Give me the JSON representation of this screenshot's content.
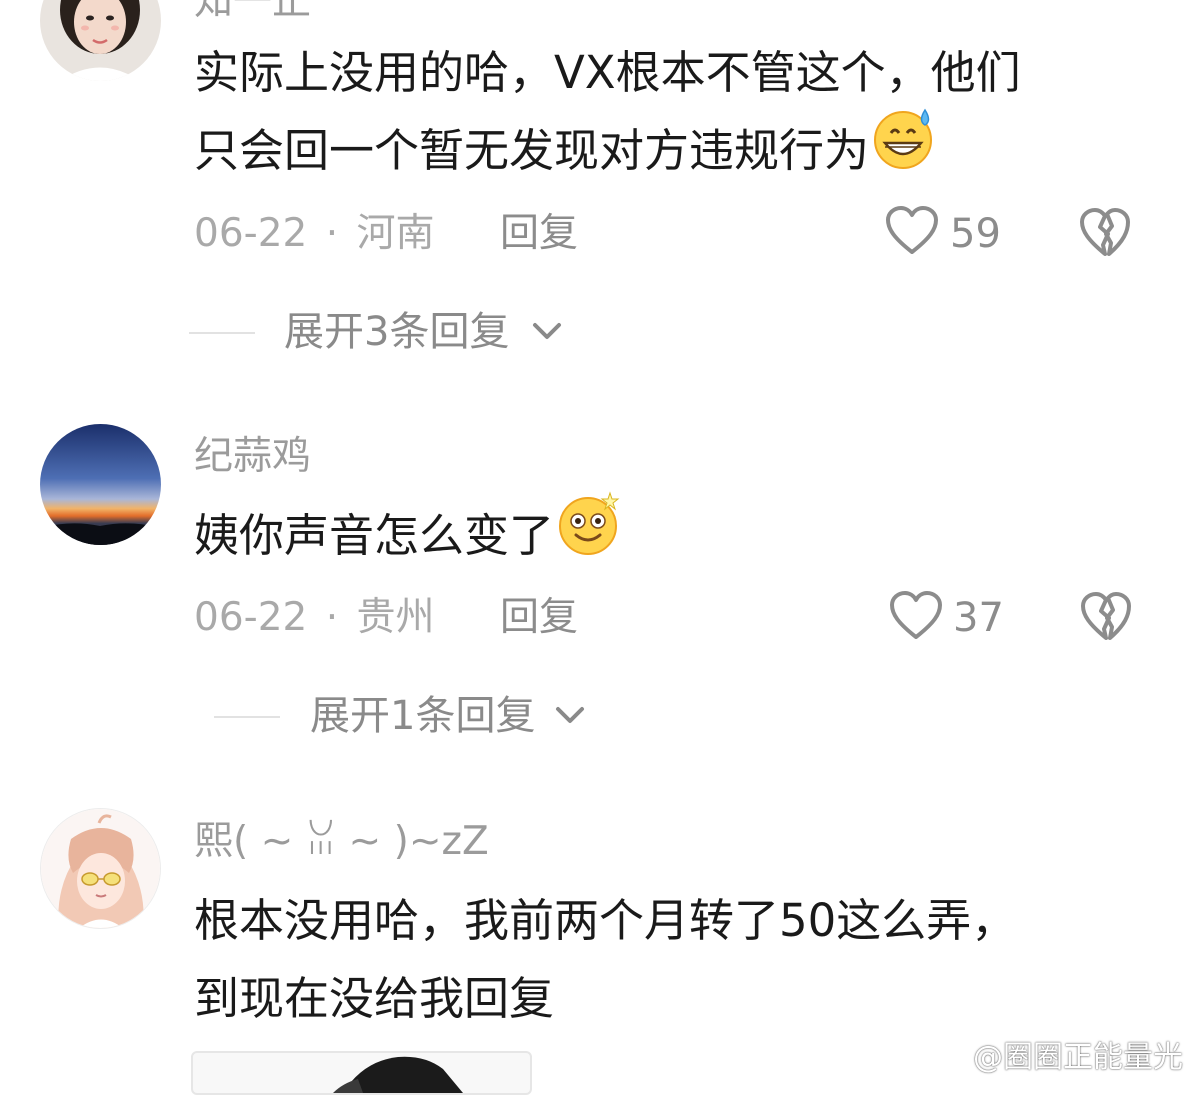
{
  "colors": {
    "text": "#1a1a1a",
    "meta": "#a9a9a9",
    "action": "#8c8c8c",
    "divider": "#e2e2e2"
  },
  "comments": [
    {
      "username": "知一正",
      "lines": [
        "实际上没用的哈，VX根本不管这个，他们",
        "只会回一个暂无发现对方违规行为"
      ],
      "emoji": "grinning-sweat-emoji",
      "date": "06-22",
      "separator": "·",
      "location": "河南",
      "reply_label": "回复",
      "likes": "59",
      "expand_label": "展开3条回复",
      "avatar": "woman-photo-avatar"
    },
    {
      "username": "纪蒜鸡",
      "lines": [
        "姨你声音怎么变了"
      ],
      "emoji": "dizzy-smile-emoji",
      "date": "06-22",
      "separator": "·",
      "location": "贵州",
      "reply_label": "回复",
      "likes": "37",
      "expand_label": "展开1条回复",
      "avatar": "sunset-avatar"
    },
    {
      "username": "熙( ~ ꈍ ~ )~zZ",
      "lines": [
        "根本没用哈，我前两个月转了50这么弄，",
        "到现在没给我回复"
      ],
      "avatar": "anime-girl-avatar"
    }
  ],
  "watermark": {
    "text": "@圈圈正能量光",
    "icon": "weibo-icon"
  }
}
